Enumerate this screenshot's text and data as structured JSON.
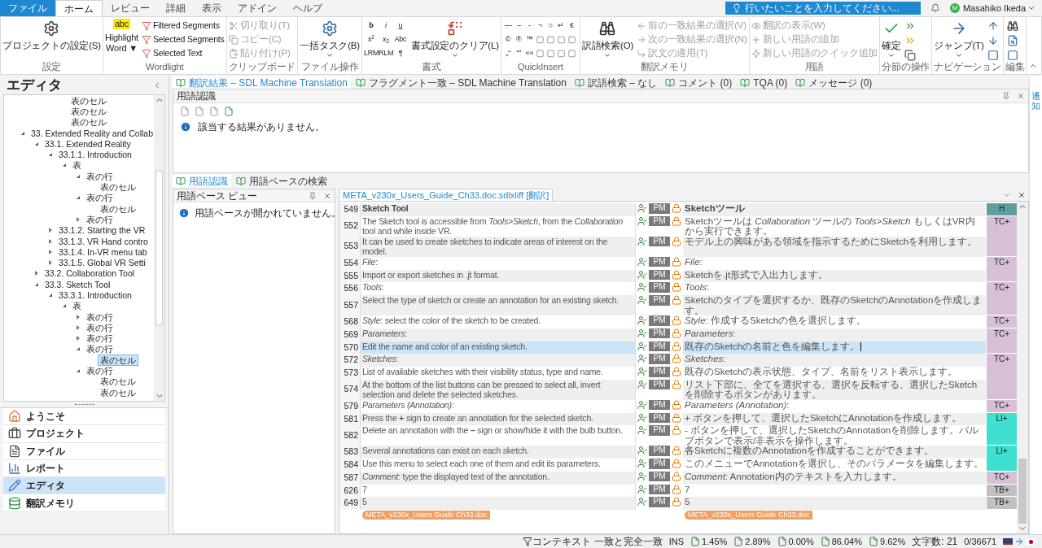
{
  "menu_tabs": [
    {
      "label": "ファイル",
      "kind": "file",
      "selected": false
    },
    {
      "label": "ホーム",
      "kind": "tab",
      "selected": true
    },
    {
      "label": "レビュー",
      "kind": "tab",
      "selected": false
    },
    {
      "label": "詳細",
      "kind": "tab",
      "selected": false
    },
    {
      "label": "表示",
      "kind": "tab",
      "selected": false
    },
    {
      "label": "アドイン",
      "kind": "tab",
      "selected": false
    },
    {
      "label": "ヘルプ",
      "kind": "tab",
      "selected": false
    }
  ],
  "tell_me": {
    "placeholder": "行いたいことを入力してください..."
  },
  "user": {
    "initial": "M",
    "name": "Masahiko Ikeda"
  },
  "ribbon": {
    "settings": {
      "title": "設定",
      "button": "プロジェクトの設定(S)"
    },
    "wordlight": {
      "title": "Wordlight",
      "highlight_icon": "abc",
      "highlight": [
        "Highlight",
        "Word ▼"
      ],
      "items": [
        "Filtered Segments",
        "Selected Segments",
        "Selected Text"
      ]
    },
    "clipboard": {
      "title": "クリップボード",
      "items": [
        {
          "label": "切り取り(T)",
          "disabled": true
        },
        {
          "label": "コピー(C)",
          "disabled": true
        },
        {
          "label": "貼り付け(P)",
          "disabled": true
        }
      ]
    },
    "file_ops": {
      "title": "ファイル操作",
      "button": "一括タスク(B)"
    },
    "format": {
      "title": "書式",
      "buttons": [
        "b",
        "i",
        "u",
        "x$^{2}$",
        "x$_{2}$",
        "Abc",
        "LRM",
        "RLM",
        "¶"
      ],
      "clear": "書式設定のクリア(L)"
    },
    "quickinsert": {
      "title": "QuickInsert",
      "rows": [
        [
          "—",
          "–",
          "-",
          "¬",
          "○",
          "↵",
          "€"
        ],
        [
          "©",
          "®",
          "™"
        ],
        [
          "„“",
          "“”",
          "«»"
        ]
      ]
    },
    "tm": {
      "title": "翻訳メモリ",
      "button": "訳語検索(O)",
      "items": [
        {
          "label": "前の一致結果の選択(V)",
          "disabled": true
        },
        {
          "label": "次の一致結果の選択(N)",
          "disabled": true
        },
        {
          "label": "訳文の適用(T)",
          "disabled": true
        }
      ]
    },
    "terms": {
      "title": "用語",
      "items": [
        {
          "label": "翻訳の表示(W)",
          "disabled": true
        },
        {
          "label": "新しい用語の追加",
          "disabled": true
        },
        {
          "label": "新しい用語のクイック追加",
          "disabled": true
        }
      ]
    },
    "segment_ops": {
      "title": "分節の操作",
      "button": "確定"
    },
    "navigation": {
      "title": "ナビゲーション",
      "button": "ジャンプ(T)"
    },
    "edit": {
      "title": "編集"
    }
  },
  "side_panel": {
    "title": "エディタ"
  },
  "tree": {
    "continued": [
      "表のセル",
      "表のセル",
      "表のセル"
    ],
    "items": [
      {
        "label": "33. Extended Reality and Collab",
        "expanded": true,
        "selected": false,
        "children": [
          {
            "label": "33.1.  Extended Reality",
            "expanded": true,
            "selected": false,
            "children": [
              {
                "label": "33.1.1.  Introduction",
                "expanded": true,
                "selected": false,
                "children": [
                  {
                    "label": "表",
                    "expanded": true,
                    "selected": false,
                    "children": [
                      {
                        "label": "表の行",
                        "expanded": true,
                        "selected": false,
                        "children": [
                          {
                            "label": "表のセル",
                            "selected": false
                          }
                        ]
                      },
                      {
                        "label": "表の行",
                        "expanded": true,
                        "selected": false,
                        "children": [
                          {
                            "label": "表のセル",
                            "selected": false
                          }
                        ]
                      },
                      {
                        "label": "表の行",
                        "expanded": false,
                        "selected": false
                      }
                    ]
                  }
                ]
              },
              {
                "label": "33.1.2.  Starting the VR",
                "expanded": false,
                "selected": false
              },
              {
                "label": "33.1.3.  VR Hand contro",
                "expanded": false,
                "selected": false
              },
              {
                "label": "33.1.4.  In-VR menu tab",
                "expanded": false,
                "selected": false
              },
              {
                "label": "33.1.5.  Global VR Setti",
                "expanded": false,
                "selected": false
              }
            ]
          },
          {
            "label": "33.2.  Collaboration Tool",
            "expanded": false,
            "selected": false
          },
          {
            "label": "33.3.  Sketch Tool",
            "expanded": true,
            "selected": false,
            "children": [
              {
                "label": "33.3.1.  Introduction",
                "expanded": true,
                "selected": false,
                "children": [
                  {
                    "label": "表",
                    "expanded": true,
                    "selected": false,
                    "children": [
                      {
                        "label": "表の行",
                        "expanded": false,
                        "selected": false
                      },
                      {
                        "label": "表の行",
                        "expanded": false,
                        "selected": false
                      },
                      {
                        "label": "表の行",
                        "expanded": false,
                        "selected": false
                      },
                      {
                        "label": "表の行",
                        "expanded": true,
                        "selected": false,
                        "children": [
                          {
                            "label": "表のセル",
                            "selected": true
                          }
                        ]
                      },
                      {
                        "label": "表の行",
                        "expanded": true,
                        "selected": false,
                        "children": [
                          {
                            "label": "表のセル",
                            "selected": false
                          },
                          {
                            "label": "表のセル",
                            "selected": false
                          }
                        ]
                      }
                    ]
                  }
                ]
              }
            ]
          }
        ]
      }
    ]
  },
  "nav": [
    {
      "label": "ようこそ",
      "selected": false
    },
    {
      "label": "プロジェクト",
      "selected": false
    },
    {
      "label": "ファイル",
      "selected": false
    },
    {
      "label": "レポート",
      "selected": false
    },
    {
      "label": "エディタ",
      "selected": true
    },
    {
      "label": "翻訳メモリ",
      "selected": false
    }
  ],
  "result_tabs": [
    {
      "label": "翻訳結果 – SDL Machine Translation",
      "selected": true
    },
    {
      "label": "フラグメント一致 – SDL Machine Translation",
      "selected": false
    },
    {
      "label": "訳語検索 – なし",
      "selected": false
    },
    {
      "label": "コメント (0)",
      "selected": false
    },
    {
      "label": "TQA (0)",
      "selected": false
    },
    {
      "label": "メッセージ (0)",
      "selected": false
    }
  ],
  "term_recognition": {
    "title": "用語認識",
    "message": "該当する結果がありません。"
  },
  "term_tabs": [
    {
      "label": "用語認識",
      "selected": true
    },
    {
      "label": "用語ベースの検索",
      "selected": false
    }
  ],
  "termbase_view": {
    "title": "用語ベース ビュー",
    "message": "用語ベースが開かれていません。"
  },
  "side_strip": {
    "label": "通知"
  },
  "editor": {
    "file_tab": "META_v230x_Users_Guide_Ch33.doc.sdlxliff [翻訳]",
    "groups": [
      {
        "label": "H",
        "color": "#5f9ea0",
        "rows": [
          {
            "id": "549",
            "source": "Sketch Tool",
            "target": "Sketchツール",
            "status": "PM",
            "heading": true,
            "selected": false
          }
        ]
      },
      {
        "label": "TC+",
        "color": "#d8bfd8",
        "rows": [
          {
            "id": "552",
            "source": "The Sketch tool is accessible from *Tools>Sketch*, from the *Collaboration* tool and while inside VR.",
            "target": "Sketchツールは *Collaboration* ツールの *Tools>Sketch* もしくはVR内から実行できます。",
            "status": "PM",
            "heading": false,
            "selected": false
          },
          {
            "id": "553",
            "source": "It can be used to create sketches to indicate areas of interest on the model.",
            "target": "モデル上の興味がある領域を指示するためにSketchを利用します。",
            "status": "PM",
            "heading": false,
            "selected": false
          }
        ]
      },
      {
        "label": "TC+",
        "color": "#d8bfd8",
        "rows": [
          {
            "id": "554",
            "source": "*File*:",
            "target": "*File*:",
            "status": "PM",
            "heading": false,
            "selected": false
          },
          {
            "id": "555",
            "source": "Import or export sketches in .jt format.",
            "target": "Sketchを.jt形式で入出力します。",
            "status": "PM",
            "heading": false,
            "selected": false
          }
        ]
      },
      {
        "label": "TC+",
        "color": "#d8bfd8",
        "rows": [
          {
            "id": "556",
            "source": "*Tools*:",
            "target": "*Tools*:",
            "status": "PM",
            "heading": false,
            "selected": false
          },
          {
            "id": "557",
            "source": "Select the type of sketch or create an annotation for an existing sketch.",
            "target": "Sketchのタイプを選択するか、既存のSketchのAnnotationを作成します。",
            "status": "PM",
            "heading": false,
            "selected": false
          }
        ]
      },
      {
        "label": "TC+",
        "color": "#d8bfd8",
        "rows": [
          {
            "id": "568",
            "source": "*Style*: select the color of the sketch to be created.",
            "target": "*Style*: 作成するSketchの色を選択します。",
            "status": "PM",
            "heading": false,
            "selected": false
          }
        ]
      },
      {
        "label": "TC+",
        "color": "#d8bfd8",
        "rows": [
          {
            "id": "569",
            "source": "*Parameters*:",
            "target": "*Parameters*:",
            "status": "PM",
            "heading": false,
            "selected": false
          },
          {
            "id": "570",
            "source": "Edit the name and color of an existing sketch.",
            "target": "既存のSketchの名前と色を編集します。",
            "status": "PM",
            "heading": false,
            "selected": true
          }
        ]
      },
      {
        "label": "TC+",
        "color": "#d8bfd8",
        "rows": [
          {
            "id": "572",
            "source": "*Sketches*:",
            "target": "*Sketches*:",
            "status": "PM",
            "heading": false,
            "selected": false
          },
          {
            "id": "573",
            "source": "List of available sketches with their visibility status, type and name.",
            "target": "既存のSketchの表示状態、タイプ、名前をリスト表示します。",
            "status": "PM",
            "heading": false,
            "selected": false
          },
          {
            "id": "574",
            "source": "At the bottom of the list buttons can be pressed to select all, invert selection and delete the selected sketches.",
            "target": "リスト下部に、全てを選択する、選択を反転する、選択したSketchを削除するボタンがあります。",
            "status": "PM",
            "heading": false,
            "selected": false
          }
        ]
      },
      {
        "label": "TC+",
        "color": "#d8bfd8",
        "rows": [
          {
            "id": "579",
            "source": "*Parameters (Annotation)*:",
            "target": "*Parameters (Annotation)*:",
            "status": "PM",
            "heading": false,
            "selected": false
          }
        ]
      },
      {
        "label": "LI+",
        "color": "#40e0d0",
        "rows": [
          {
            "id": "581",
            "source": "Press the **+** sign to create an annotation for the selected sketch.",
            "target": "+ ボタンを押して、選択したSketchにAnnotationを作成します。",
            "status": "PM",
            "heading": false,
            "selected": false
          },
          {
            "id": "582",
            "source": "Delete an annotation with the **–** sign or show/hide it with the bulb button.",
            "target": "- ボタンを押して、選択したSketchのAnnotationを削除します。バルブボタンで表示/非表示を操作します。",
            "status": "PM",
            "heading": false,
            "selected": false
          }
        ]
      },
      {
        "label": "LI+",
        "color": "#40e0d0",
        "rows": [
          {
            "id": "583",
            "source": "Several annotations can exist on each sketch.",
            "target": "各Sketchに複数のAnnotationを作成することができます。",
            "status": "PM",
            "heading": false,
            "selected": false
          },
          {
            "id": "584",
            "source": "Use this menu to select each one of them and edit its parameters.",
            "target": "このメニューでAnnotationを選択し、そのパラメータを編集します。",
            "status": "PM",
            "heading": false,
            "selected": false
          }
        ]
      },
      {
        "label": "TC+",
        "color": "#d8bfd8",
        "rows": [
          {
            "id": "587",
            "source": "*Comment*: type the displayed text of the annotation.",
            "target": "*Comment*: Annotation内のテキストを入力します。",
            "status": "PM",
            "heading": false,
            "selected": false
          }
        ]
      },
      {
        "label": "TB+",
        "color": "#c0c0c0",
        "rows": [
          {
            "id": "626",
            "source": "7",
            "target": "7",
            "status": "PM",
            "heading": false,
            "selected": false
          }
        ]
      },
      {
        "label": "TB+",
        "color": "#c0c0c0",
        "rows": [
          {
            "id": "649",
            "source": "5",
            "target": "5",
            "status": "PM",
            "heading": false,
            "selected": false
          }
        ]
      }
    ],
    "end_tags": [
      "META_v230x_Users Guide Ch33.doc",
      "META_v230x_Users Guide Ch33.doc"
    ]
  },
  "status_bar": {
    "filter": "コンテキスト 一致と完全一致",
    "mode": "INS",
    "stats": [
      "1.45%",
      "2.89%",
      "0.00%",
      "86.04%",
      "9.62%"
    ],
    "chars": "文字数: 21",
    "progress": "0/36671"
  }
}
